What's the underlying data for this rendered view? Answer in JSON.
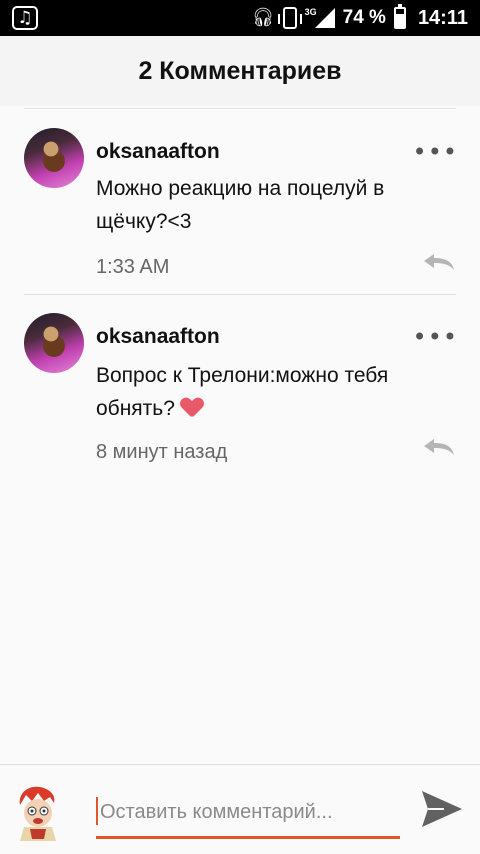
{
  "status_bar": {
    "network": "3G",
    "battery_percent": "74 %",
    "battery_level": 0.74,
    "time": "14:11"
  },
  "header": {
    "title": "2 Комментариев"
  },
  "comments": [
    {
      "username": "oksanaafton",
      "text": "Можно реакцию на поцелуй в щёчку?<3",
      "time": "1:33 AM"
    },
    {
      "username": "oksanaafton",
      "text": "Вопрос к Трелони:можно тебя обнять?",
      "time": "8 минут назад"
    }
  ],
  "compose": {
    "placeholder": "Оставить комментарий..."
  },
  "colors": {
    "accent": "#e0572a",
    "status_bar": "#000000",
    "header_bg": "#f4f4f4"
  },
  "icons": {
    "status_left": "music-note-icon",
    "more": "more-dots-icon",
    "reply": "reply-arrow-icon",
    "send": "send-icon"
  }
}
